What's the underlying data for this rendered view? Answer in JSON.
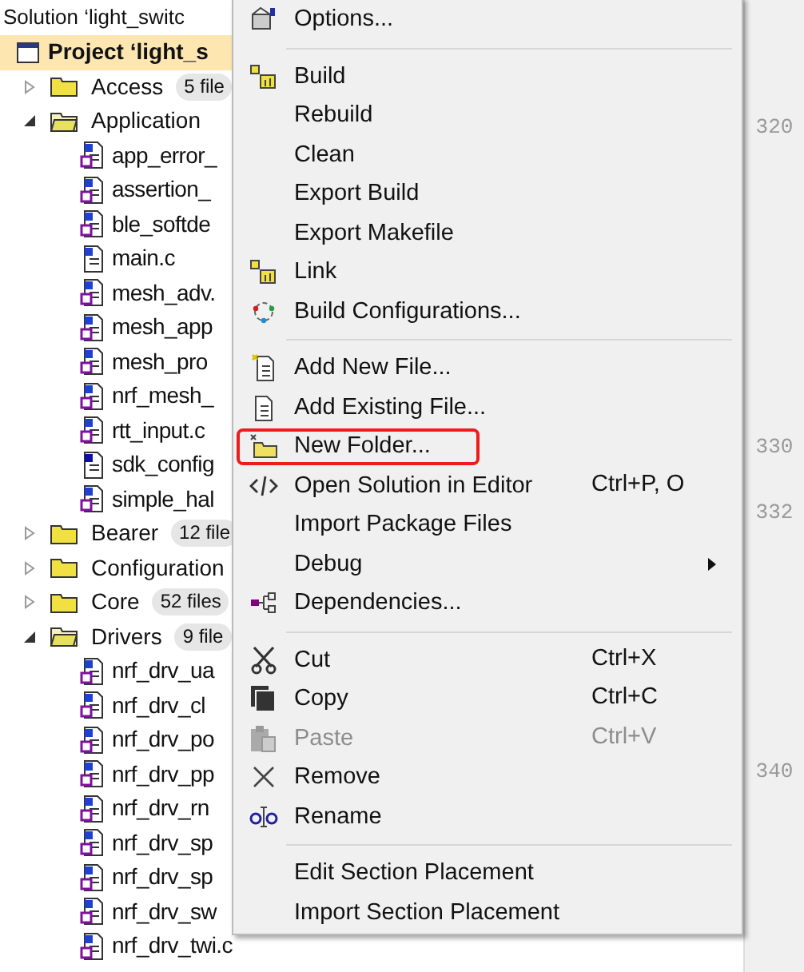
{
  "tree": {
    "label": "Solution ‘light_switc",
    "children": [
      {
        "kind": "project",
        "label": "Project ‘light_s",
        "selected": true,
        "children": [
          {
            "kind": "folder",
            "label": "Access",
            "badge": "5 file",
            "expanded": false
          },
          {
            "kind": "folder",
            "label": "Application",
            "expanded": true,
            "children": [
              {
                "kind": "c_file",
                "linked": true,
                "label": "app_error_"
              },
              {
                "kind": "c_file",
                "linked": true,
                "label": "assertion_"
              },
              {
                "kind": "c_file",
                "linked": true,
                "label": "ble_softde"
              },
              {
                "kind": "c_file",
                "linked": false,
                "label": "main.c"
              },
              {
                "kind": "c_file",
                "linked": true,
                "label": "mesh_adv."
              },
              {
                "kind": "c_file",
                "linked": true,
                "label": "mesh_app"
              },
              {
                "kind": "c_file",
                "linked": true,
                "label": "mesh_pro"
              },
              {
                "kind": "c_file",
                "linked": true,
                "label": "nrf_mesh_"
              },
              {
                "kind": "c_file",
                "linked": true,
                "label": "rtt_input.c"
              },
              {
                "kind": "h_file",
                "linked": false,
                "label": "sdk_config"
              },
              {
                "kind": "c_file",
                "linked": true,
                "label": "simple_hal"
              }
            ]
          },
          {
            "kind": "folder",
            "label": "Bearer",
            "badge": "12 file",
            "expanded": false
          },
          {
            "kind": "folder",
            "label": "Configuration",
            "expanded": false
          },
          {
            "kind": "folder",
            "label": "Core",
            "badge": "52 files",
            "expanded": false
          },
          {
            "kind": "folder",
            "label": "Drivers",
            "badge": "9 file",
            "expanded": true,
            "children": [
              {
                "kind": "c_file",
                "linked": true,
                "label": "nrf_drv_ua"
              },
              {
                "kind": "c_file",
                "linked": true,
                "label": "nrf_drv_cl"
              },
              {
                "kind": "c_file",
                "linked": true,
                "label": "nrf_drv_po"
              },
              {
                "kind": "c_file",
                "linked": true,
                "label": "nrf_drv_pp"
              },
              {
                "kind": "c_file",
                "linked": true,
                "label": "nrf_drv_rn"
              },
              {
                "kind": "c_file",
                "linked": true,
                "label": "nrf_drv_sp"
              },
              {
                "kind": "c_file",
                "linked": true,
                "label": "nrf_drv_sp"
              },
              {
                "kind": "c_file",
                "linked": true,
                "label": "nrf_drv_sw"
              },
              {
                "kind": "c_file",
                "linked": true,
                "label": "nrf_drv_twi.c"
              }
            ]
          }
        ]
      }
    ]
  },
  "line_numbers": [
    "320",
    "330",
    "332",
    "340"
  ],
  "context_menu": [
    {
      "kind": "item",
      "label": "Options...",
      "disabled": false,
      "outlined": false
    },
    {
      "kind": "separator"
    },
    {
      "kind": "item",
      "label": "Build",
      "disabled": false,
      "outlined": false
    },
    {
      "kind": "item",
      "label": "Rebuild",
      "disabled": false,
      "outlined": false
    },
    {
      "kind": "item",
      "label": "Clean",
      "disabled": false,
      "outlined": false
    },
    {
      "kind": "item",
      "label": "Export Build",
      "disabled": false,
      "outlined": false
    },
    {
      "kind": "item",
      "label": "Export Makefile",
      "disabled": false,
      "outlined": false
    },
    {
      "kind": "item",
      "label": "Link",
      "disabled": false,
      "outlined": false
    },
    {
      "kind": "item",
      "label": "Build Configurations...",
      "disabled": false,
      "outlined": false
    },
    {
      "kind": "separator"
    },
    {
      "kind": "item",
      "label": "Add New File...",
      "disabled": false,
      "outlined": false
    },
    {
      "kind": "item",
      "label": "Add Existing File...",
      "disabled": false,
      "outlined": false
    },
    {
      "kind": "item",
      "label": "New Folder...",
      "disabled": false,
      "outlined": true
    },
    {
      "kind": "item",
      "label": "Open Solution in Editor",
      "shortcut": "Ctrl+P, O",
      "disabled": false,
      "outlined": false
    },
    {
      "kind": "item",
      "label": "Import Package Files",
      "disabled": false,
      "outlined": false
    },
    {
      "kind": "submenu",
      "label": "Debug",
      "disabled": false,
      "outlined": false
    },
    {
      "kind": "item",
      "label": "Dependencies...",
      "disabled": false,
      "outlined": false
    },
    {
      "kind": "separator"
    },
    {
      "kind": "item",
      "label": "Cut",
      "shortcut": "Ctrl+X",
      "disabled": false,
      "outlined": false
    },
    {
      "kind": "item",
      "label": "Copy",
      "shortcut": "Ctrl+C",
      "disabled": false,
      "outlined": false
    },
    {
      "kind": "item",
      "label": "Paste",
      "shortcut": "Ctrl+V",
      "disabled": true,
      "outlined": false
    },
    {
      "kind": "item",
      "label": "Remove",
      "disabled": false,
      "outlined": false
    },
    {
      "kind": "item",
      "label": "Rename",
      "disabled": false,
      "outlined": false
    },
    {
      "kind": "separator"
    },
    {
      "kind": "item",
      "label": "Edit Section Placement",
      "disabled": false,
      "outlined": false
    },
    {
      "kind": "item",
      "label": "Import Section Placement",
      "disabled": false,
      "outlined": false
    }
  ]
}
